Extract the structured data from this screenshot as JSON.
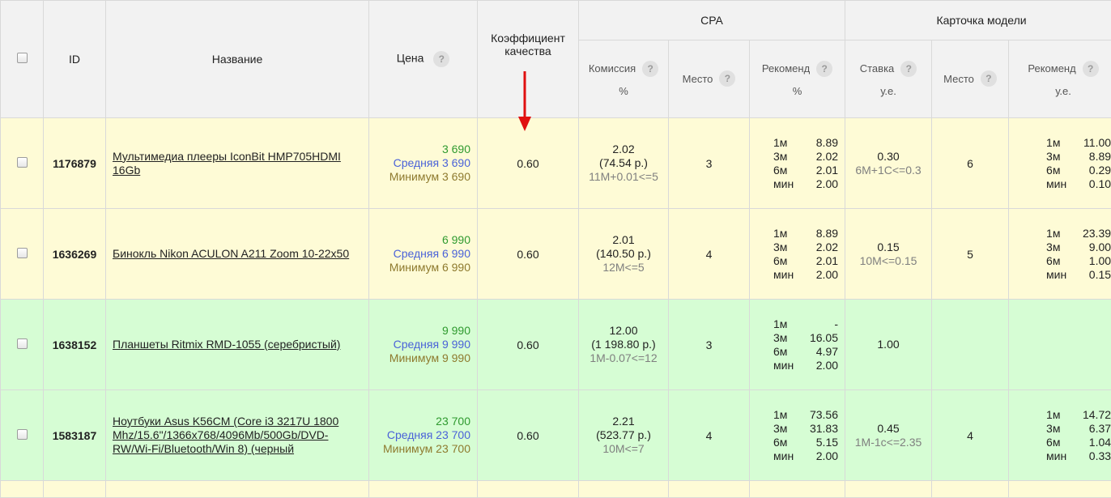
{
  "header": {
    "id": "ID",
    "name": "Название",
    "price": "Цена",
    "quality_line1": "Коэффициент",
    "quality_line2": "качества",
    "group_cpa": "CPA",
    "group_card": "Карточка модели",
    "cpa_commission": "Комиссия",
    "cpa_commission_unit": "%",
    "cpa_place": "Место",
    "cpa_recommend": "Рекоменд",
    "cpa_recommend_unit": "%",
    "card_bid": "Ставка",
    "card_bid_unit": "у.е.",
    "card_place": "Место",
    "card_recommend": "Рекоменд",
    "card_recommend_unit": "у.е.",
    "help_icon_glyph": "?"
  },
  "rows": [
    {
      "color": "yellow",
      "id": "1176879",
      "name": "Мультимедиа плееры IconBit HMP705HDMI 16Gb",
      "price": "3 690",
      "avg": "Средняя 3 690",
      "min": "Минимум 3 690",
      "quality": "0.60",
      "commission": "2.02",
      "commission_rub": "(74.54 р.)",
      "commission_formula": "11М+0.01<=5",
      "cpa_place": "3",
      "cpa_rec": [
        [
          "1м",
          "8.89"
        ],
        [
          "3м",
          "2.02"
        ],
        [
          "6м",
          "2.01"
        ],
        [
          "мин",
          "2.00"
        ]
      ],
      "bid": "0.30",
      "bid_formula": "6М+1С<=0.3",
      "card_place": "6",
      "card_rec": [
        [
          "1м",
          "11.00"
        ],
        [
          "3м",
          "8.89"
        ],
        [
          "6м",
          "0.29"
        ],
        [
          "мин",
          "0.10"
        ]
      ]
    },
    {
      "color": "yellow",
      "id": "1636269",
      "name": "Бинокль Nikon ACULON A211 Zoom 10-22x50",
      "price": "6 990",
      "avg": "Средняя 6 990",
      "min": "Минимум 6 990",
      "quality": "0.60",
      "commission": "2.01",
      "commission_rub": "(140.50 р.)",
      "commission_formula": "12М<=5",
      "cpa_place": "4",
      "cpa_rec": [
        [
          "1м",
          "8.89"
        ],
        [
          "3м",
          "2.02"
        ],
        [
          "6м",
          "2.01"
        ],
        [
          "мин",
          "2.00"
        ]
      ],
      "bid": "0.15",
      "bid_formula": "10М<=0.15",
      "card_place": "5",
      "card_rec": [
        [
          "1м",
          "23.39"
        ],
        [
          "3м",
          "9.00"
        ],
        [
          "6м",
          "1.00"
        ],
        [
          "мин",
          "0.15"
        ]
      ]
    },
    {
      "color": "green",
      "id": "1638152",
      "name": "Планшеты Ritmix RMD-1055 (серебристый)",
      "price": "9 990",
      "avg": "Средняя 9 990",
      "min": "Минимум 9 990",
      "quality": "0.60",
      "commission": "12.00",
      "commission_rub": "(1 198.80 р.)",
      "commission_formula": "1М-0.07<=12",
      "cpa_place": "3",
      "cpa_rec": [
        [
          "1м",
          "-"
        ],
        [
          "3м",
          "16.05"
        ],
        [
          "6м",
          "4.97"
        ],
        [
          "мин",
          "2.00"
        ]
      ],
      "bid": "1.00",
      "bid_formula": "",
      "card_place": "",
      "card_rec": []
    },
    {
      "color": "green",
      "id": "1583187",
      "name": "Ноутбуки Asus K56CM (Core i3 3217U 1800 Mhz/15.6\"/1366x768/4096Mb/500Gb/DVD-RW/Wi-Fi/Bluetooth/Win 8) (черный",
      "price": "23 700",
      "avg": "Средняя 23 700",
      "min": "Минимум 23 700",
      "quality": "0.60",
      "commission": "2.21",
      "commission_rub": "(523.77 р.)",
      "commission_formula": "10М<=7",
      "cpa_place": "4",
      "cpa_rec": [
        [
          "1м",
          "73.56"
        ],
        [
          "3м",
          "31.83"
        ],
        [
          "6м",
          "5.15"
        ],
        [
          "мин",
          "2.00"
        ]
      ],
      "bid": "0.45",
      "bid_formula": "1М-1с<=2.35",
      "card_place": "4",
      "card_rec": [
        [
          "1м",
          "14.72"
        ],
        [
          "3м",
          "6.37"
        ],
        [
          "6м",
          "1.04"
        ],
        [
          "мин",
          "0.33"
        ]
      ]
    }
  ],
  "colors": {
    "row_yellow": "#fefbd6",
    "row_green": "#d6fdd4",
    "price_main": "#2f9a2f",
    "price_avg": "#4a62d8",
    "price_min": "#8e7a2e",
    "arrow": "#e01010"
  }
}
